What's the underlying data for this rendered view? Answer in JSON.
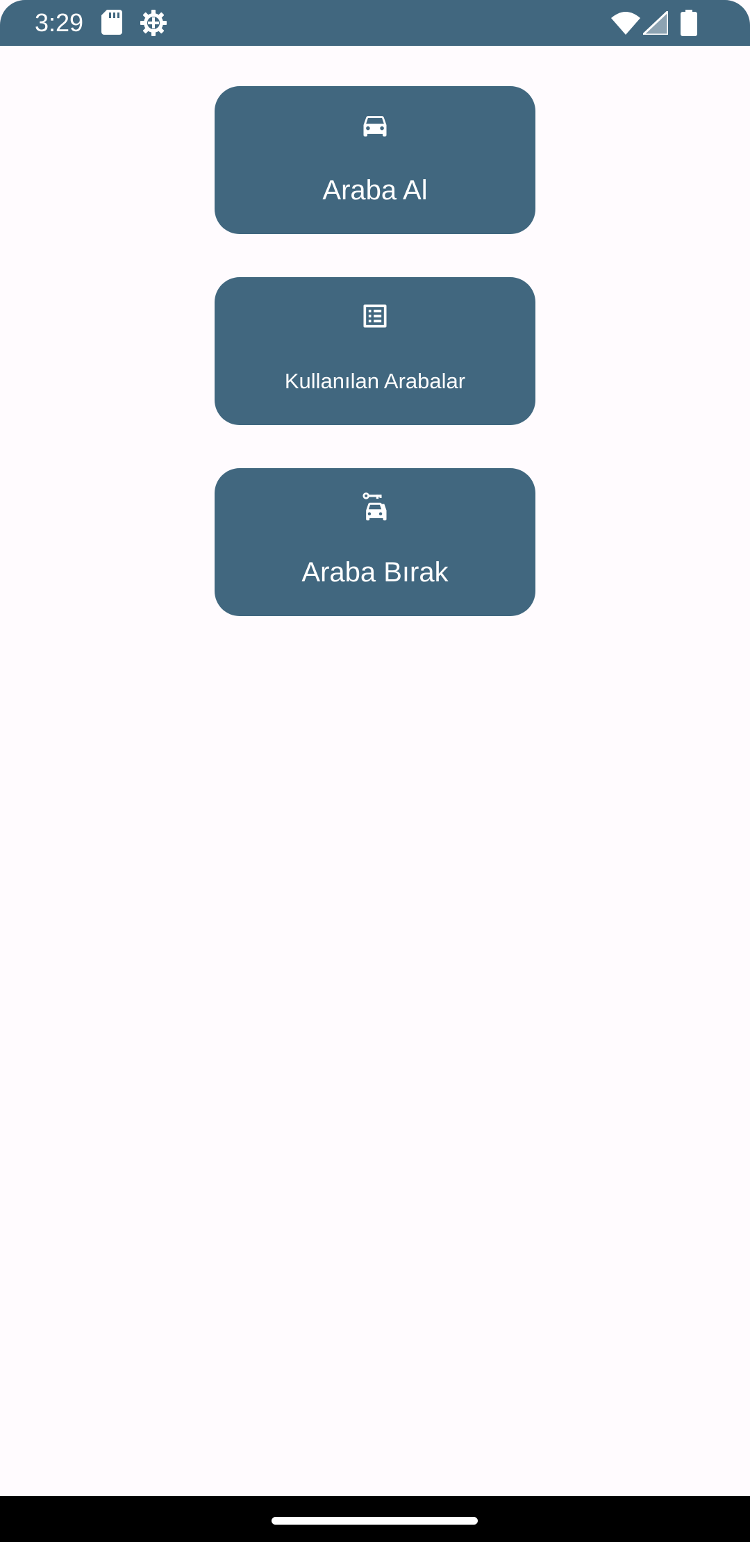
{
  "status_bar": {
    "time": "3:29",
    "background_color": "#41677F",
    "icons": [
      "sd-card-icon",
      "settings-gear-icon",
      "wifi-icon",
      "cell-signal-icon",
      "battery-icon"
    ]
  },
  "main": {
    "button_color": "#41677F",
    "buttons": [
      {
        "label": "Araba Al",
        "icon": "car-icon"
      },
      {
        "label": "Kullanılan Arabalar",
        "icon": "list-icon"
      },
      {
        "label": "Araba Bırak",
        "icon": "car-key-icon"
      }
    ]
  },
  "navigation_bar": {
    "background_color": "#000000",
    "handle": "home-gesture-handle"
  }
}
